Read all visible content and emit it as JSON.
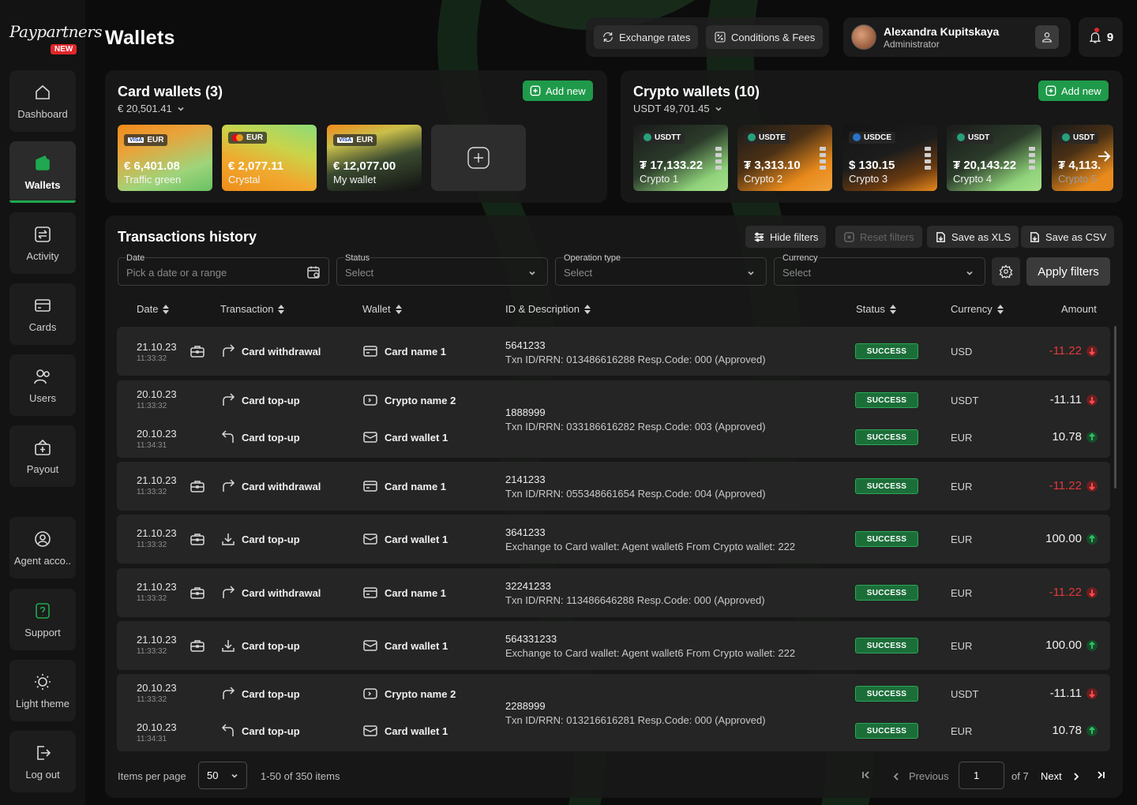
{
  "brand": {
    "logo_text": "Paypartners",
    "badge": "NEW"
  },
  "page_title": "Wallets",
  "sidebar": {
    "items": [
      {
        "label": "Dashboard"
      },
      {
        "label": "Wallets"
      },
      {
        "label": "Activity"
      },
      {
        "label": "Cards"
      },
      {
        "label": "Users"
      },
      {
        "label": "Payout"
      },
      {
        "label": "Agent acco.."
      },
      {
        "label": "Support"
      },
      {
        "label": "Light theme"
      },
      {
        "label": "Log out"
      }
    ]
  },
  "header": {
    "exchange_rates": "Exchange rates",
    "conditions_fees": "Conditions & Fees",
    "user_name": "Alexandra Kupitskaya",
    "user_role": "Administrator",
    "notifications": "9"
  },
  "card_wallets": {
    "title": "Card wallets (3)",
    "total": "€ 20,501.41",
    "add_label": "Add new",
    "cards": [
      {
        "currency": "EUR",
        "amount": "€ 6,401.08",
        "name": "Traffic green"
      },
      {
        "currency": "EUR",
        "amount": "€ 2,077.11",
        "name": "Crystal"
      },
      {
        "currency": "EUR",
        "amount": "€ 12,077.00",
        "name": "My wallet"
      }
    ]
  },
  "crypto_wallets": {
    "title": "Crypto wallets (10)",
    "total": "USDT 49,701.45",
    "add_label": "Add new",
    "cards": [
      {
        "currency": "USDTT",
        "amount": "₮ 17,133.22",
        "name": "Crypto 1"
      },
      {
        "currency": "USDTE",
        "amount": "₮ 3,313.10",
        "name": "Crypto 2"
      },
      {
        "currency": "USDCE",
        "amount": "$ 130.15",
        "name": "Crypto 3"
      },
      {
        "currency": "USDT",
        "amount": "₮ 20,143.22",
        "name": "Crypto 4"
      },
      {
        "currency": "USDT",
        "amount": "₮ 4,113.",
        "name": "Crypto 5"
      }
    ]
  },
  "transactions": {
    "title": "Transactions history",
    "hide_filters": "Hide filters",
    "reset_filters": "Reset filters",
    "save_xls": "Save as XLS",
    "save_csv": "Save as CSV",
    "apply_filters": "Apply filters",
    "filters": {
      "date_label": "Date",
      "date_placeholder": "Pick a date or a range",
      "status_label": "Status",
      "status_value": "Select",
      "optype_label": "Operation type",
      "optype_value": "Select",
      "currency_label": "Currency",
      "currency_value": "Select"
    },
    "columns": {
      "date": "Date",
      "transaction": "Transaction",
      "wallet": "Wallet",
      "id_desc": "ID & Description",
      "status": "Status",
      "currency": "Currency",
      "amount": "Amount"
    },
    "rows": [
      {
        "date": "21.10.23",
        "time": "11:33:32",
        "tx": "Card withdrawal",
        "wallet": "Card name 1",
        "id": "5641233",
        "desc": "Txn ID/RRN: 013486616288 Resp.Code: 000 (Approved)",
        "status": "SUCCESS",
        "currency": "USD",
        "amount": "-11.22"
      },
      {
        "date": "20.10.23",
        "time": "11:33:32",
        "tx": "Card top-up",
        "wallet": "Crypto name 2",
        "id": "1888999",
        "desc": "Txn ID/RRN: 033186616282 Resp.Code: 003 (Approved)",
        "status": "SUCCESS",
        "currency": "USDT",
        "amount": "-11.11",
        "date2": "20.10.23",
        "time2": "11:34:31",
        "tx2": "Card top-up",
        "wallet2": "Card wallet 1",
        "status2": "SUCCESS",
        "currency2": "EUR",
        "amount2": "10.78"
      },
      {
        "date": "21.10.23",
        "time": "11:33:32",
        "tx": "Card withdrawal",
        "wallet": "Card name 1",
        "id": "2141233",
        "desc": "Txn ID/RRN: 055348661654 Resp.Code: 004 (Approved)",
        "status": "SUCCESS",
        "currency": "EUR",
        "amount": "-11.22"
      },
      {
        "date": "21.10.23",
        "time": "11:33:32",
        "tx": "Card top-up",
        "wallet": "Card wallet 1",
        "id": "3641233",
        "desc": "Exchange to Card wallet: Agent wallet6 From Crypto wallet: 222",
        "status": "SUCCESS",
        "currency": "EUR",
        "amount": "100.00"
      },
      {
        "date": "21.10.23",
        "time": "11:33:32",
        "tx": "Card withdrawal",
        "wallet": "Card name 1",
        "id": "32241233",
        "desc": "Txn ID/RRN: 113486646288 Resp.Code: 000 (Approved)",
        "status": "SUCCESS",
        "currency": "EUR",
        "amount": "-11.22"
      },
      {
        "date": "21.10.23",
        "time": "11:33:32",
        "tx": "Card top-up",
        "wallet": "Card wallet 1",
        "id": "564331233",
        "desc": "Exchange to Card wallet: Agent wallet6 From Crypto wallet: 222",
        "status": "SUCCESS",
        "currency": "EUR",
        "amount": "100.00"
      },
      {
        "date": "20.10.23",
        "time": "11:33:32",
        "tx": "Card top-up",
        "wallet": "Crypto name 2",
        "id": "2288999",
        "desc": "Txn ID/RRN: 013216616281 Resp.Code: 000 (Approved)",
        "status": "SUCCESS",
        "currency": "USDT",
        "amount": "-11.11",
        "date2": "20.10.23",
        "time2": "11:34:31",
        "tx2": "Card top-up",
        "wallet2": "Card wallet 1",
        "status2": "SUCCESS",
        "currency2": "EUR",
        "amount2": "10.78"
      }
    ]
  },
  "pagination": {
    "items_per_page_label": "Items per page",
    "items_per_page": "50",
    "range": "1-50 of 350 items",
    "previous": "Previous",
    "page": "1",
    "of": "of 7",
    "next": "Next"
  },
  "colors": {
    "accent": "#1f9a4a",
    "negative": "#e3383b",
    "background": "#0b0c0b"
  }
}
